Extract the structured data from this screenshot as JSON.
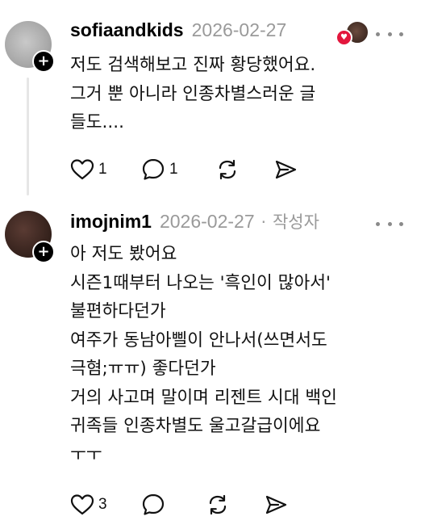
{
  "posts": [
    {
      "username": "sofiaandkids",
      "date": "2026-02-27",
      "author_tag": "",
      "text": "저도 검색해보고 진짜 황당했어요.\n그거 뿐 아니라 인종차별스러운 글\n들도....",
      "likes": "1",
      "replies": "1",
      "reposts": "",
      "shares": ""
    },
    {
      "username": "imojnim1",
      "date": "2026-02-27",
      "separator": "·",
      "author_tag": "작성자",
      "text": "아 저도 봤어요\n시즌1때부터 나오는 '흑인이 많아서'\n불편하다던가\n여주가 동남아삘이 안나서(쓰면서도\n극혐;ㅠㅠ) 좋다던가\n거의 사고며 말이며 리젠트 시대 백인\n귀족들 인종차별도 울고갈급이에요\nㅜㅜ",
      "likes": "3",
      "replies": "",
      "reposts": "",
      "shares": ""
    }
  ],
  "icons": {
    "follow": "plus-icon",
    "more": "more-icon",
    "like": "heart-icon",
    "reply": "comment-icon",
    "repost": "repost-icon",
    "share": "share-icon"
  },
  "plus_glyph": "+",
  "colors": {
    "text": "#111111",
    "muted": "#9a9a9a",
    "heart": "#e3173d"
  }
}
